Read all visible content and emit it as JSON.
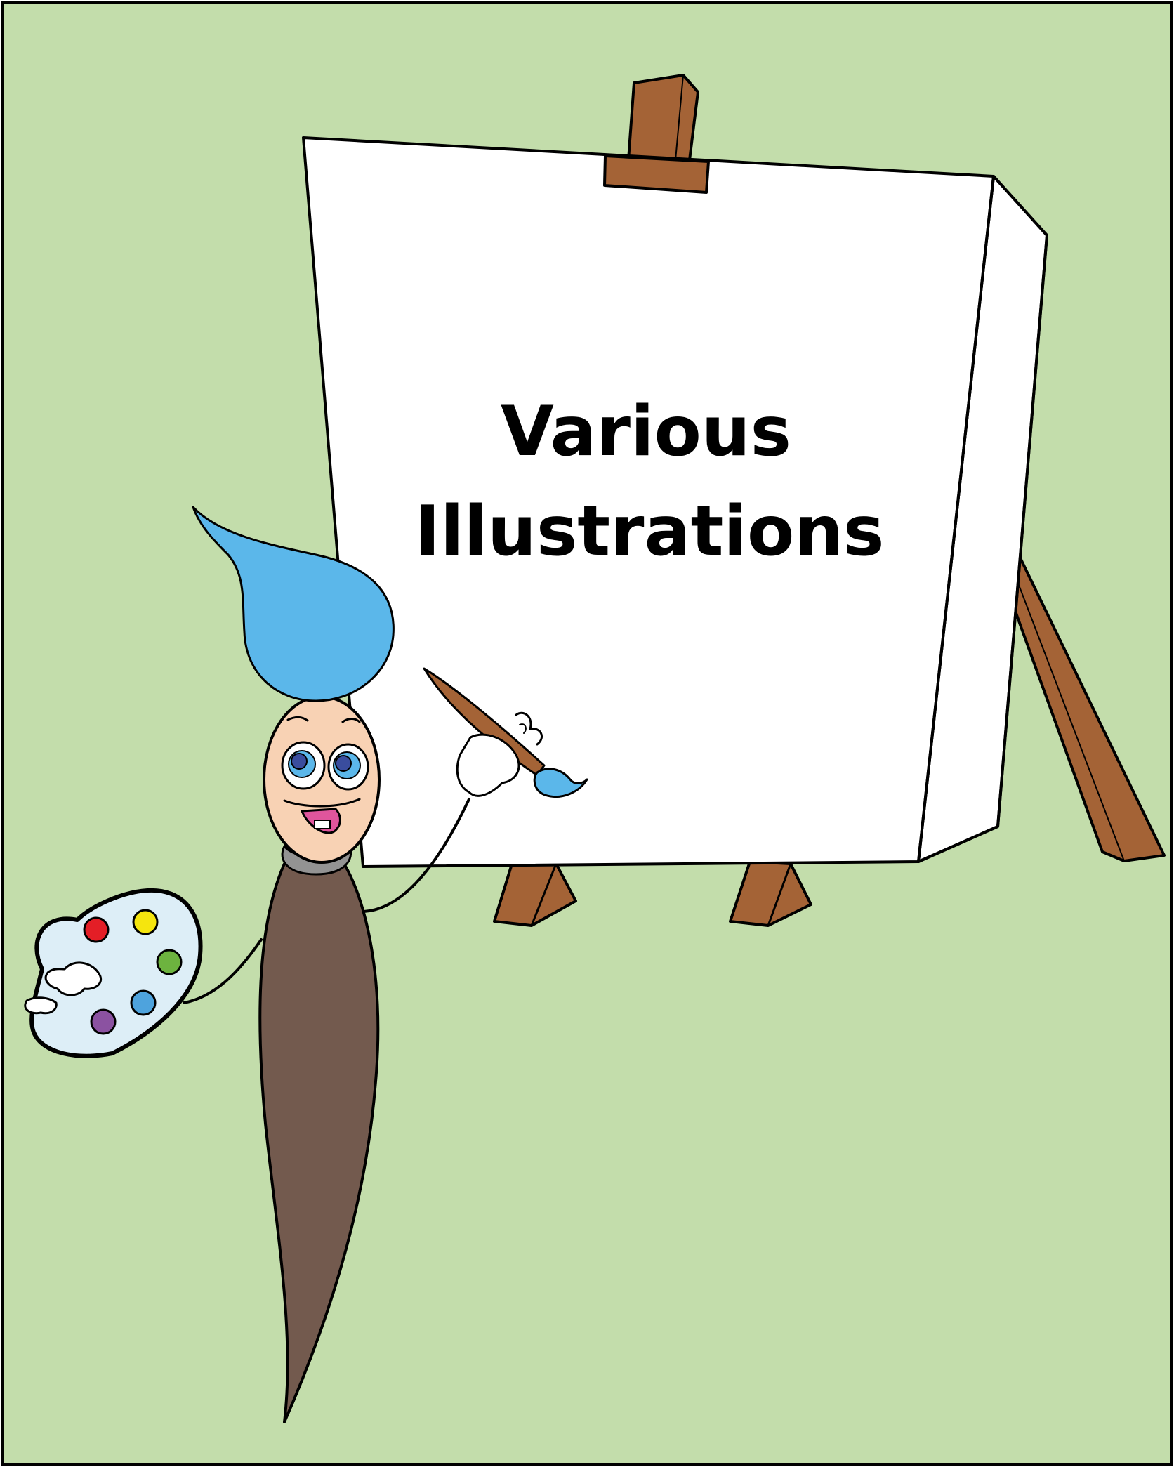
{
  "canvas": {
    "title_line_1": "Various",
    "title_line_2": "Illustrations"
  },
  "colors": {
    "background": "#c3ddab",
    "easel_wood": "#a46336",
    "canvas_white": "#ffffff",
    "hair_blue": "#5bb7ea",
    "face_skin": "#f8d2b4",
    "brush_handle": "#735a4e",
    "ferrule_gray": "#939393",
    "palette_light_blue": "#ddeef7",
    "paint_red": "#e41e26",
    "paint_yellow": "#f5e50e",
    "paint_green": "#6db33f",
    "paint_blue": "#4ea3dd",
    "paint_purple": "#8b52a1",
    "mouth_pink": "#e0559c"
  },
  "icons": [
    "easel",
    "blank-canvas",
    "paintbrush-character",
    "paint-palette",
    "small-paintbrush"
  ]
}
